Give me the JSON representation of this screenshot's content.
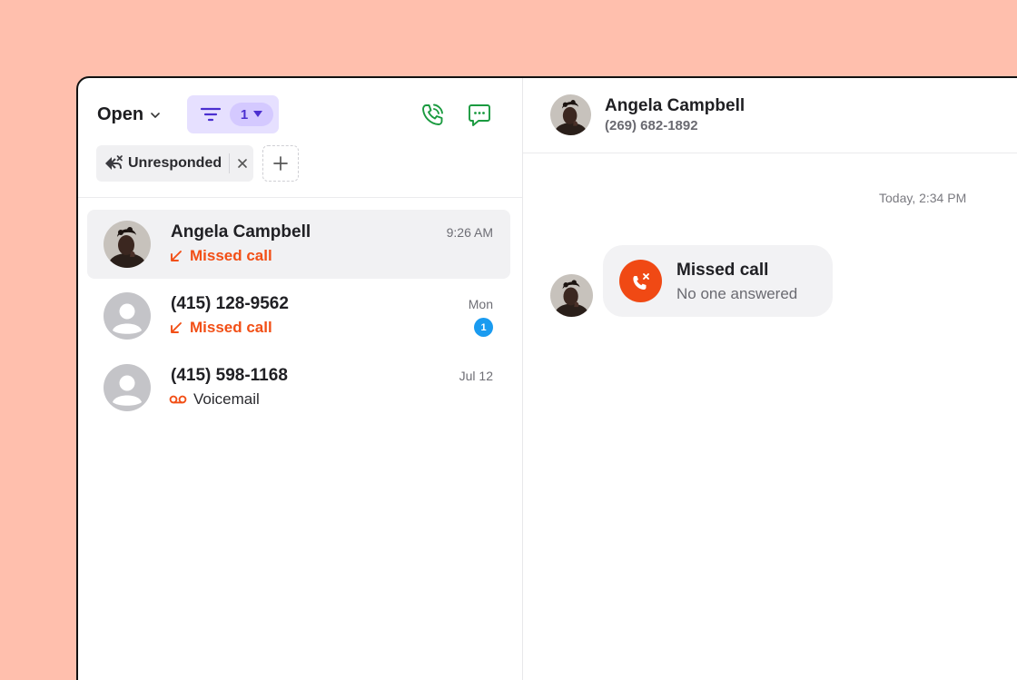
{
  "left": {
    "status_dropdown": "Open",
    "filter_count": "1",
    "chip_label": "Unresponded",
    "conversations": [
      {
        "name": "Angela Campbell",
        "type": "Missed call",
        "time": "9:26 AM",
        "badge": "",
        "avatar": "photo"
      },
      {
        "name": "(415) 128-9562",
        "type": "Missed call",
        "time": "Mon",
        "badge": "1",
        "avatar": "placeholder"
      },
      {
        "name": "(415) 598-1168",
        "type": "Voicemail",
        "time": "Jul 12",
        "badge": "",
        "avatar": "placeholder"
      }
    ]
  },
  "right": {
    "contact_name": "Angela Campbell",
    "contact_phone": "(269) 682-1892",
    "timestamp": "Today, 2:34 PM",
    "message": {
      "title": "Missed call",
      "subtitle": "No one answered"
    }
  },
  "colors": {
    "background": "#ffbfad",
    "accent_purple": "#4b2fd0",
    "filter_bg": "#e6e0ff",
    "missed_orange": "#f24f16",
    "call_green": "#1a9a3f",
    "badge_blue": "#1a9bf0"
  },
  "icons": {
    "dropdown": "chevron-down-icon",
    "filter": "filter-icon",
    "call": "phone-icon",
    "message": "chat-icon",
    "unresponded": "reply-all-x-icon",
    "remove": "close-icon",
    "add": "plus-icon",
    "missed": "arrow-down-left-icon",
    "voicemail": "voicemail-icon",
    "missed_call_bubble": "phone-missed-icon"
  }
}
